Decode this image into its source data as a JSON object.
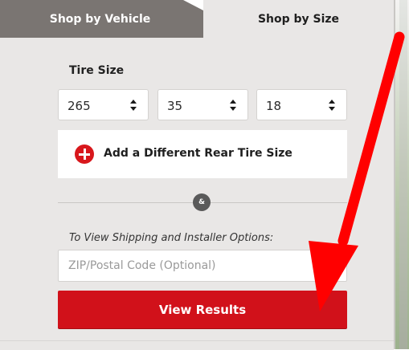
{
  "tabs": {
    "vehicle_label": "Shop by Vehicle",
    "size_label": "Shop by Size",
    "active": "size"
  },
  "tire_size": {
    "label": "Tire Size",
    "width_value": "265",
    "ratio_value": "35",
    "rim_value": "18"
  },
  "rear": {
    "label": "Add a Different Rear Tire Size"
  },
  "divider": {
    "badge_text": "&"
  },
  "shipping": {
    "label": "To View Shipping and Installer Options:",
    "zip_placeholder": "ZIP/Postal Code (Optional)",
    "zip_value": ""
  },
  "actions": {
    "view_results_label": "View Results"
  },
  "colors": {
    "accent_red": "#d1111a",
    "tab_inactive_bg": "#7a7572",
    "panel_bg": "#e9e7e6",
    "annotation_arrow": "#ff0000"
  },
  "icons": {
    "select_caret": "up-down-caret-icon",
    "add_rear": "plus-circle-icon",
    "annotation": "red-arrow-annotation"
  }
}
